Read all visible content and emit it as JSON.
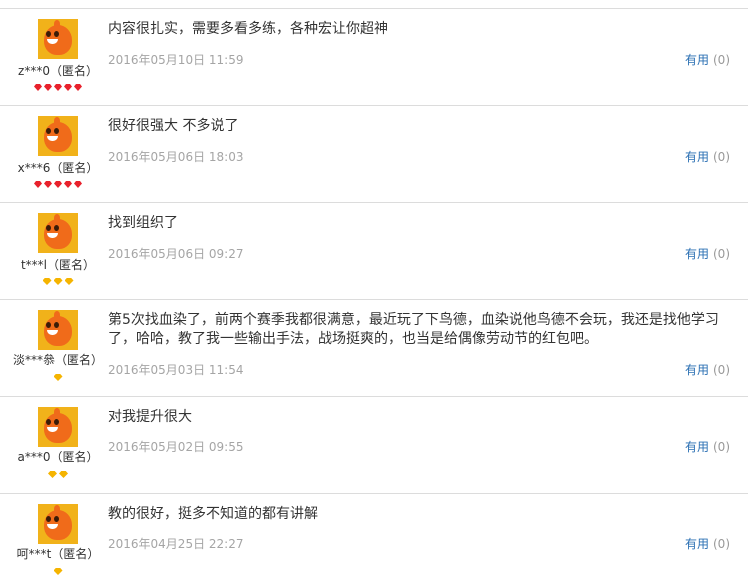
{
  "reviews": [
    {
      "username": "z***0（匿名）",
      "content": "内容很扎实，需要多看多练，各种宏让你超神",
      "date": "2016年05月10日 11:59",
      "useful_label": "有用",
      "useful_count": "(0)",
      "badge_type": "red-gem",
      "badge_count": 5
    },
    {
      "username": "x***6（匿名）",
      "content": "很好很强大 不多说了",
      "date": "2016年05月06日 18:03",
      "useful_label": "有用",
      "useful_count": "(0)",
      "badge_type": "red-gem",
      "badge_count": 5
    },
    {
      "username": "t***l（匿名）",
      "content": "找到组织了",
      "date": "2016年05月06日 09:27",
      "useful_label": "有用",
      "useful_count": "(0)",
      "badge_type": "yellow-diamond",
      "badge_count": 3
    },
    {
      "username": "淡***叅（匿名）",
      "content": "第5次找血染了，前两个赛季我都很满意，最近玩了下鸟德，血染说他鸟德不会玩，我还是找他学习了，哈哈，教了我一些输出手法，战场挺爽的，也当是给偶像劳动节的红包吧。",
      "date": "2016年05月03日 11:54",
      "useful_label": "有用",
      "useful_count": "(0)",
      "badge_type": "yellow-diamond",
      "badge_count": 1
    },
    {
      "username": "a***0（匿名）",
      "content": "对我提升很大",
      "date": "2016年05月02日 09:55",
      "useful_label": "有用",
      "useful_count": "(0)",
      "badge_type": "yellow-diamond",
      "badge_count": 2
    },
    {
      "username": "呵***t（匿名）",
      "content": "教的很好，挺多不知道的都有讲解",
      "date": "2016年04月25日 22:27",
      "useful_label": "有用",
      "useful_count": "(0)",
      "badge_type": "yellow-diamond",
      "badge_count": 1
    }
  ],
  "colors": {
    "useful_link": "#2a6fb3",
    "date_text": "#a5a5a5",
    "divider": "#dcdcdc",
    "red_gem": "#e8212c",
    "yellow_diamond": "#f5b400"
  }
}
